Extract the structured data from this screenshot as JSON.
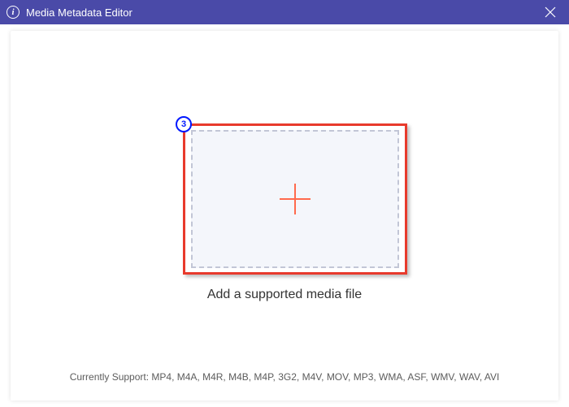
{
  "titlebar": {
    "title": "Media Metadata Editor"
  },
  "badge": {
    "number": "3"
  },
  "main": {
    "drop_label": "Add a supported media file",
    "support_text": "Currently Support: MP4, M4A, M4R, M4B, M4P, 3G2, M4V, MOV, MP3, WMA, ASF, WMV, WAV, AVI"
  }
}
